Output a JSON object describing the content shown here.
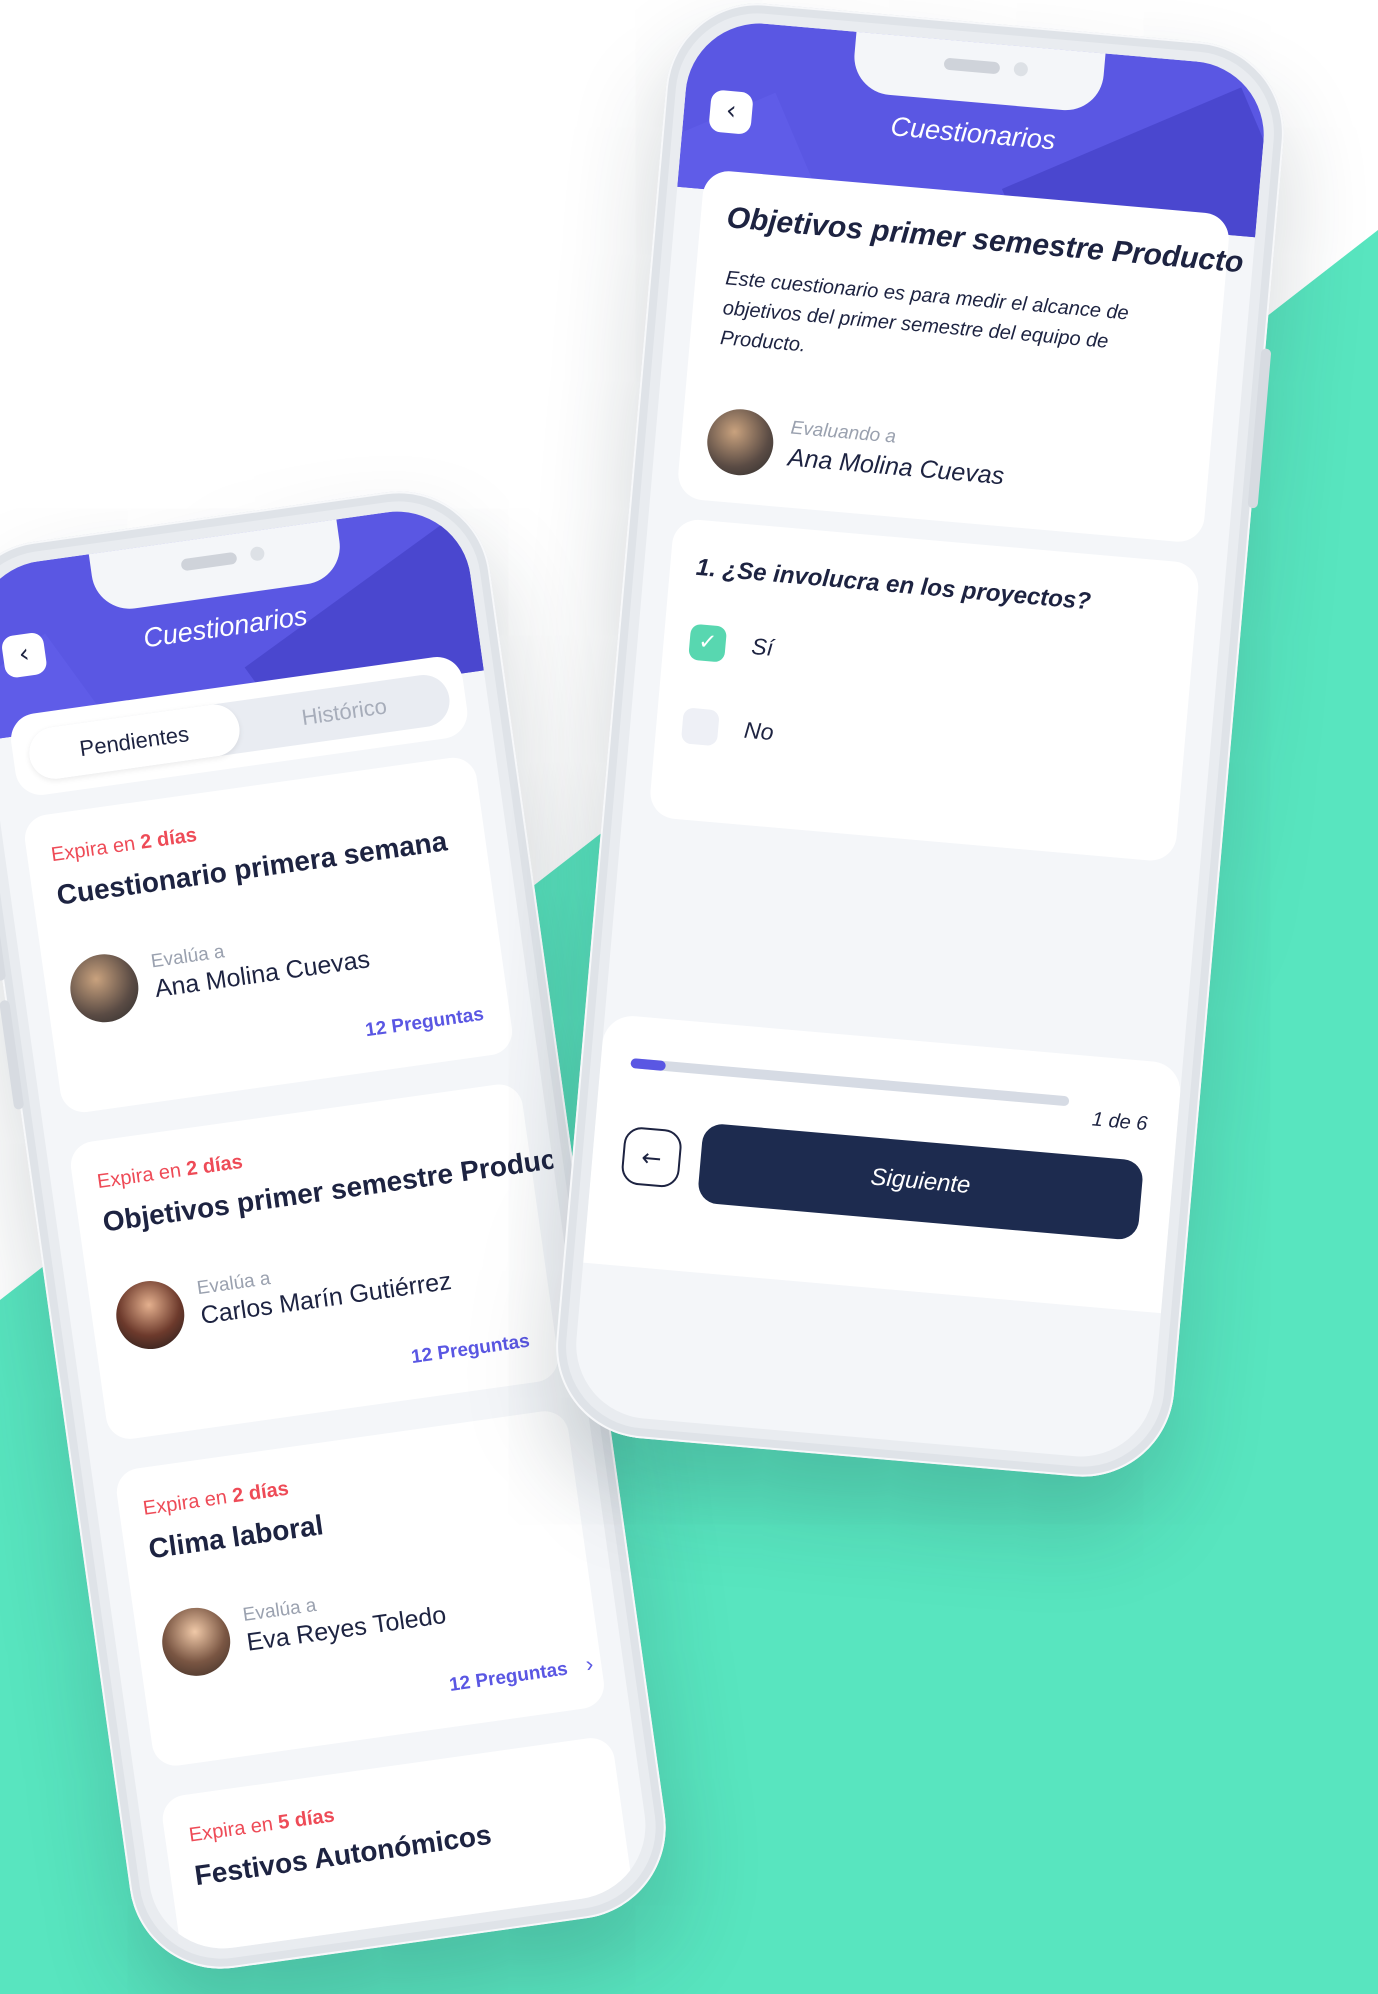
{
  "colors": {
    "accent": "#5a57e3",
    "background_teal": "#58e5bf",
    "expiry_red": "#ee4b57",
    "navy": "#1d2b4f",
    "check_green": "#58d7b0"
  },
  "left_phone": {
    "header": {
      "title": "Cuestionarios",
      "back_icon": "‹"
    },
    "tabs": [
      {
        "label": "Pendientes",
        "active": true
      },
      {
        "label": "Histórico",
        "active": false
      }
    ],
    "cards": [
      {
        "expira_prefix": "Expira en ",
        "expira_value": "2 días",
        "title": "Cuestionario primera semana",
        "evalua_label": "Evalúa a",
        "person": "Ana Molina Cuevas",
        "preguntas": "12 Preguntas"
      },
      {
        "expira_prefix": "Expira en ",
        "expira_value": "2 días",
        "title": "Objetivos primer semestre Producto",
        "evalua_label": "Evalúa a",
        "person": "Carlos Marín Gutiérrez",
        "preguntas": "12 Preguntas"
      },
      {
        "expira_prefix": "Expira en ",
        "expira_value": "2 días",
        "title": "Clima laboral",
        "evalua_label": "Evalúa a",
        "person": "Eva Reyes Toledo",
        "preguntas": "12 Preguntas",
        "chevron": "›"
      },
      {
        "expira_prefix": "Expira en ",
        "expira_value": "5 días",
        "title": "Festivos Autonómicos"
      }
    ]
  },
  "right_phone": {
    "header": {
      "title": "Cuestionarios",
      "back_icon": "‹"
    },
    "intro": {
      "title": "Objetivos primer semestre Producto",
      "description": "Este cuestionario es para medir el alcance de objetivos del primer semestre del equipo de Producto.",
      "evaluando_label": "Evaluando a",
      "person": "Ana Molina Cuevas"
    },
    "question": {
      "text": "1. ¿Se involucra en los proyectos?",
      "options": [
        {
          "label": "Sí",
          "checked": true,
          "mark": "✓"
        },
        {
          "label": "No",
          "checked": false
        }
      ]
    },
    "footer": {
      "progress": 0.08,
      "page_count": "1 de 6",
      "prev_icon": "←",
      "next_label": "Siguiente"
    }
  }
}
